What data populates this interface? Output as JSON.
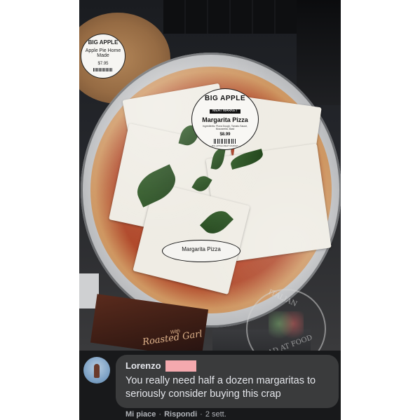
{
  "products": {
    "pie_label": {
      "brand": "BIG APPLE",
      "name": "Apple Pie Home Made",
      "price": "$7.95"
    },
    "main_label": {
      "brand": "BIG APPLE",
      "sub": "MEAT MARKET",
      "name": "Margarita Pizza",
      "ingredients": "Ingredients: Pizza Dough, Tomato Sauce, Mozzarella, Basil",
      "price": "$8.99",
      "address": "BIG APPLE MEAT MARKET"
    },
    "oval_label": "Margarita Pizza",
    "shelf_product_text": "Roasted Garl",
    "shelf_product_small": "With"
  },
  "watermark": {
    "top": "ITALIAN",
    "bottom": "MAD AT FOOD"
  },
  "comment": {
    "author": "Lorenzo",
    "text": "You really need half a dozen margaritas to seriously consider buying this crap",
    "like_label": "Mi piace",
    "reply_label": "Rispondi",
    "separator": "·",
    "time": "2 sett."
  },
  "colors": {
    "comment_bg": "#18191b",
    "bubble_bg": "#3a3b3c",
    "redaction": "#f4a9ae",
    "text_primary": "#e4e6eb",
    "text_secondary": "#b0b3b8"
  }
}
